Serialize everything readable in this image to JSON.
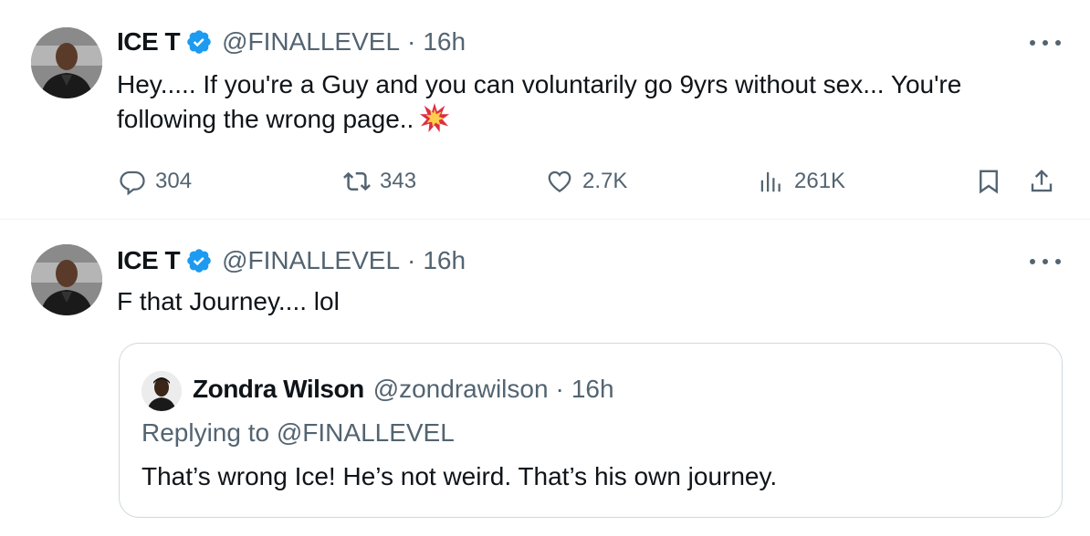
{
  "tweets": [
    {
      "author_name": "ICE T",
      "handle": "@FINALLEVEL",
      "separator": "·",
      "time": "16h",
      "text": "Hey..... If you're a Guy and you can voluntarily go 9yrs without sex... You're following the wrong page..",
      "emoji": "collision-emoji",
      "stats": {
        "replies": "304",
        "retweets": "343",
        "likes": "2.7K",
        "views": "261K"
      }
    },
    {
      "author_name": "ICE T",
      "handle": "@FINALLEVEL",
      "separator": "·",
      "time": "16h",
      "text": "F that Journey.... lol",
      "quote": {
        "author_name": "Zondra Wilson",
        "handle": "@zondrawilson",
        "separator": "·",
        "time": "16h",
        "replying_to": "Replying to @FINALLEVEL",
        "text": "That’s wrong Ice! He’s not weird. That’s his own journey."
      }
    }
  ],
  "icons": [
    "verified-badge-icon",
    "more-icon",
    "reply-icon",
    "retweet-icon",
    "like-icon",
    "views-icon",
    "bookmark-icon",
    "share-icon"
  ],
  "colors": {
    "text_primary": "#0f1419",
    "text_secondary": "#536471",
    "verified_blue": "#1d9bf0",
    "border": "#cfd9de"
  }
}
